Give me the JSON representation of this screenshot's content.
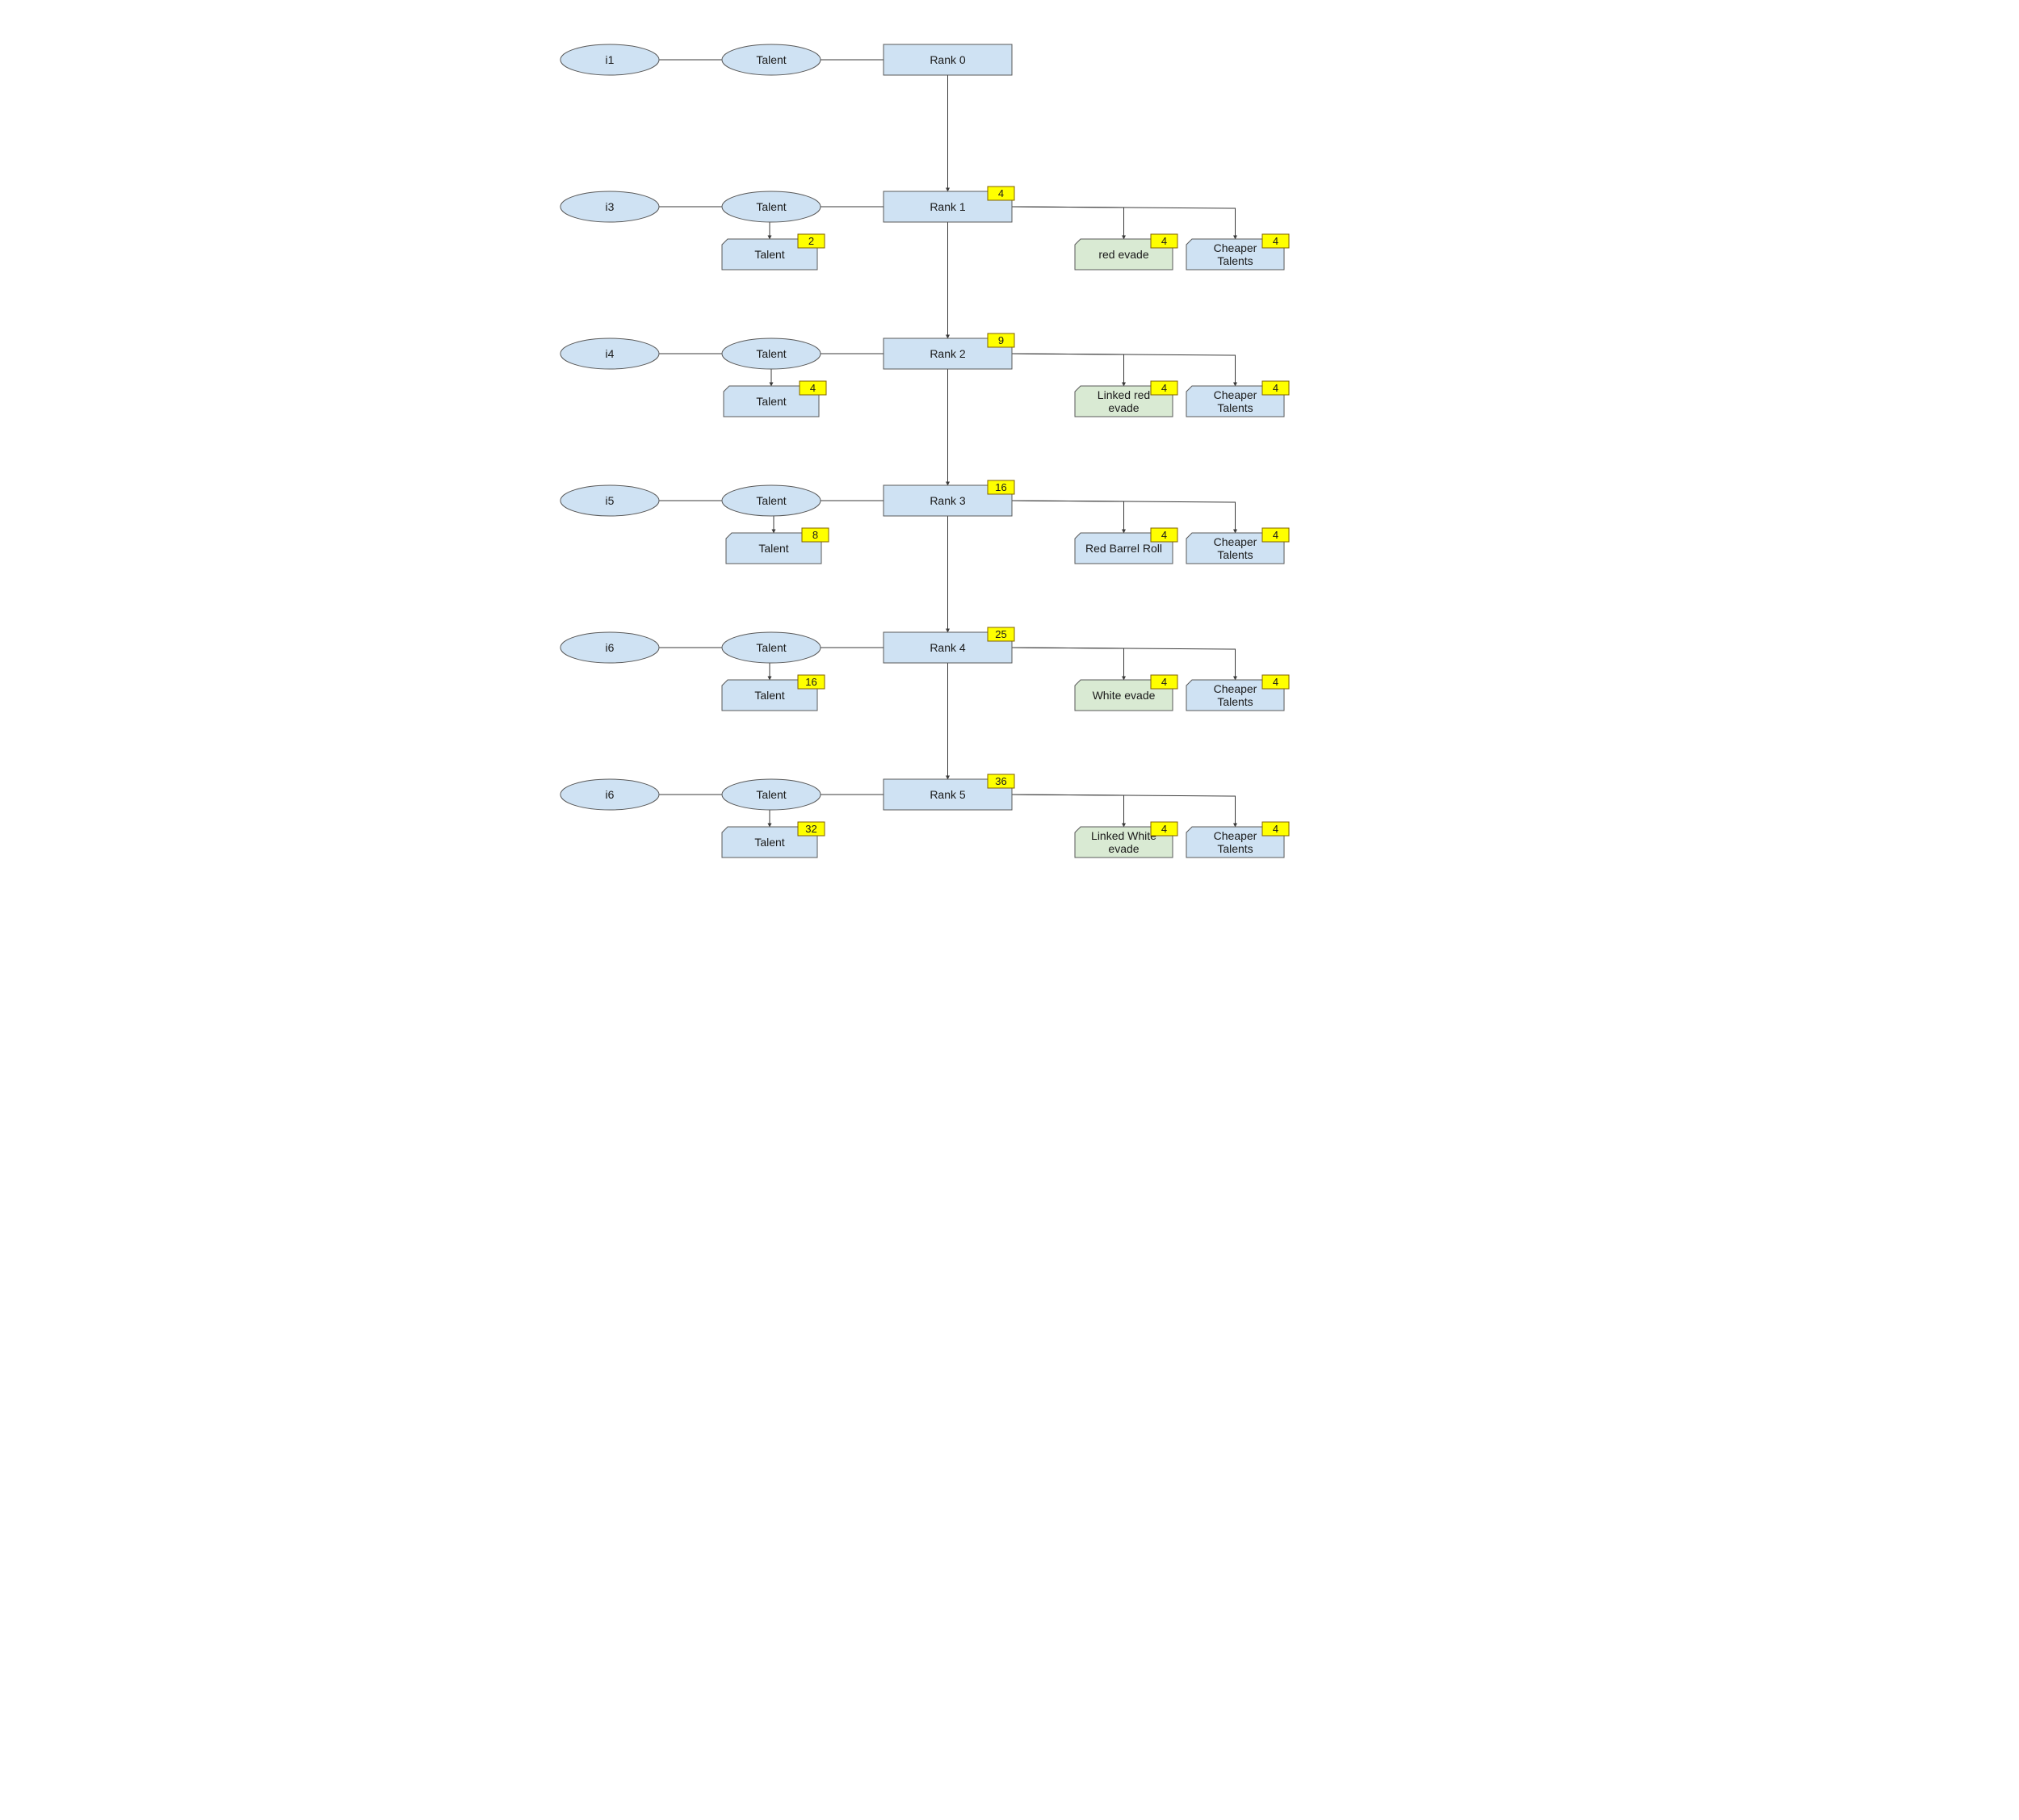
{
  "colors": {
    "node_fill": "#cfe2f3",
    "node_stroke": "#595959",
    "green_fill": "#d9ead3",
    "badge_fill": "#ffff00",
    "badge_stroke": "#7f6000",
    "edge": "#3a3a3a"
  },
  "rows": [
    {
      "id": "r0",
      "item": "i1",
      "talent_oval": "Talent",
      "rank": {
        "label": "Rank 0",
        "badge": ""
      },
      "talent_card": null,
      "rewards": []
    },
    {
      "id": "r1",
      "item": "i3",
      "talent_oval": "Talent",
      "rank": {
        "label": "Rank 1",
        "badge": "4"
      },
      "talent_card": {
        "lines": [
          "Talent"
        ],
        "badge": "2"
      },
      "rewards": [
        {
          "lines": [
            "red evade"
          ],
          "badge": "4",
          "kind": "green"
        },
        {
          "lines": [
            "Cheaper",
            "Talents"
          ],
          "badge": "4",
          "kind": "blue"
        }
      ]
    },
    {
      "id": "r2",
      "item": "i4",
      "talent_oval": "Talent",
      "rank": {
        "label": "Rank 2",
        "badge": "9"
      },
      "talent_card": {
        "lines": [
          "Talent"
        ],
        "badge": "4"
      },
      "rewards": [
        {
          "lines": [
            "Linked red",
            "evade"
          ],
          "badge": "4",
          "kind": "green"
        },
        {
          "lines": [
            "Cheaper",
            "Talents"
          ],
          "badge": "4",
          "kind": "blue"
        }
      ]
    },
    {
      "id": "r3",
      "item": "i5",
      "talent_oval": "Talent",
      "rank": {
        "label": "Rank 3",
        "badge": "16"
      },
      "talent_card": {
        "lines": [
          "Talent"
        ],
        "badge": "8"
      },
      "rewards": [
        {
          "lines": [
            "Red Barrel Roll"
          ],
          "badge": "4",
          "kind": "blue"
        },
        {
          "lines": [
            "Cheaper",
            "Talents"
          ],
          "badge": "4",
          "kind": "blue"
        }
      ]
    },
    {
      "id": "r4",
      "item": "i6",
      "talent_oval": "Talent",
      "rank": {
        "label": "Rank 4",
        "badge": "25"
      },
      "talent_card": {
        "lines": [
          "Talent"
        ],
        "badge": "16"
      },
      "rewards": [
        {
          "lines": [
            "White evade"
          ],
          "badge": "4",
          "kind": "green"
        },
        {
          "lines": [
            "Cheaper",
            "Talents"
          ],
          "badge": "4",
          "kind": "blue"
        }
      ]
    },
    {
      "id": "r5",
      "item": "i6",
      "talent_oval": "Talent",
      "rank": {
        "label": "Rank 5",
        "badge": "36"
      },
      "talent_card": {
        "lines": [
          "Talent"
        ],
        "badge": "32"
      },
      "rewards": [
        {
          "lines": [
            "Linked White",
            "evade"
          ],
          "badge": "4",
          "kind": "green"
        },
        {
          "lines": [
            "Cheaper",
            "Talents"
          ],
          "badge": "4",
          "kind": "blue"
        }
      ]
    }
  ]
}
